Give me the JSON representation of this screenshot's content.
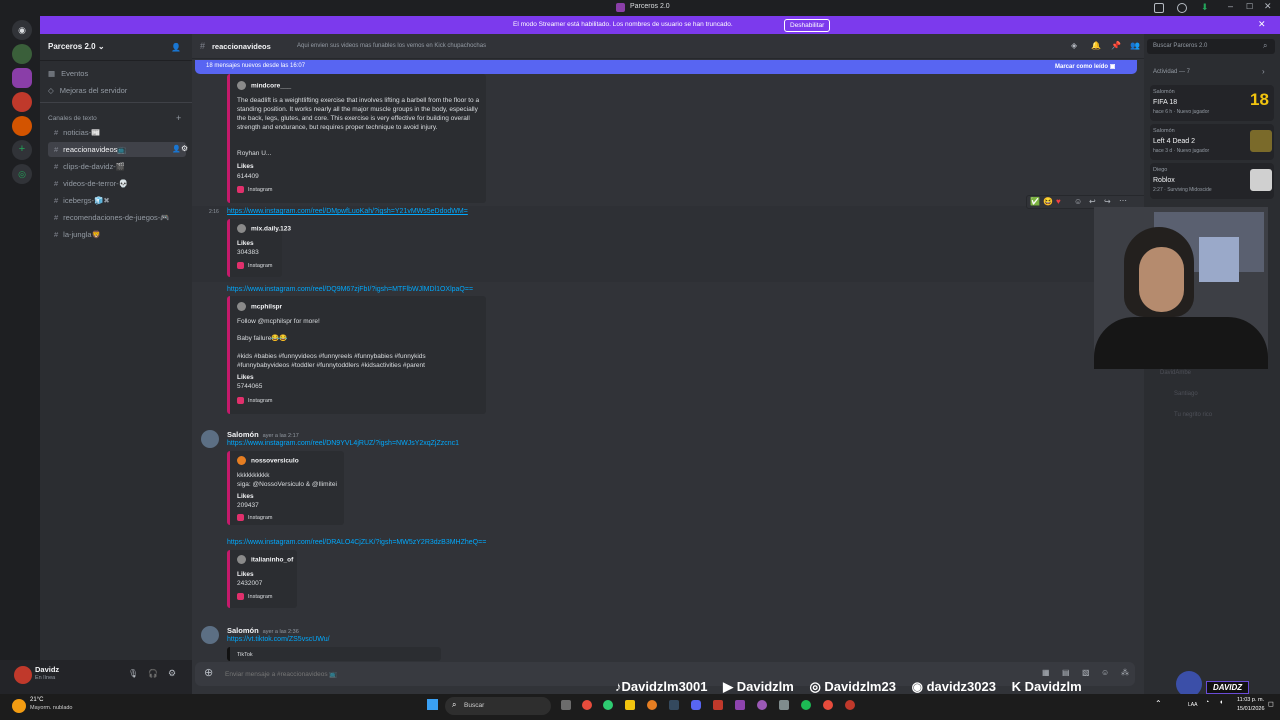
{
  "window": {
    "title": "Parceros 2.0"
  },
  "banner": {
    "text": "El modo Streamer está habilitado. Los nombres de usuario se han truncado.",
    "button": "Deshabilitar"
  },
  "server": {
    "name": "Parceros 2.0",
    "nav": [
      "Eventos",
      "Mejoras del servidor"
    ],
    "category": "Canales de texto",
    "channels": [
      {
        "name": "noticias-",
        "emoji": "📰"
      },
      {
        "name": "reaccionavideos",
        "emoji": "📺"
      },
      {
        "name": "clips-de-davidz-",
        "emoji": "🎬"
      },
      {
        "name": "videos-de-terror-",
        "emoji": "💀"
      },
      {
        "name": "icebergs-",
        "emoji": "🧊✖"
      },
      {
        "name": "recomendaciones-de-juegos-",
        "emoji": "🎮"
      },
      {
        "name": "la-jungla",
        "emoji": "🦁"
      }
    ]
  },
  "user": {
    "name": "Davidz",
    "status": "En línea"
  },
  "channel_header": {
    "name": "reaccionavideos",
    "topic": "Aqui envien sus videos mas funables los vemos en Kick chupachochas",
    "search_placeholder": "Buscar Parceros 2.0"
  },
  "new_messages": {
    "text": "18 mensajes nuevos desde las 16:07",
    "mark_read": "Marcar como leído"
  },
  "messages": {
    "embed1": {
      "author": "mindcore___",
      "body": "The deadlift is a weightlifting exercise that involves lifting a barbell from the floor to a standing position. It works nearly all the major muscle groups in the body, especially the back, legs, glutes, and core. This exercise is very effective for building overall strength and endurance, but requires proper technique to avoid injury.",
      "extra": "Royhan U...",
      "likes_label": "Likes",
      "likes": "614409",
      "source": "Instagram"
    },
    "msg2": {
      "time": "2:16",
      "link": "https://www.instagram.com/reel/DMpwfLuoKah/?igsh=Y21vMWs5eDdodWM=",
      "author": "mix.daily.123",
      "likes_label": "Likes",
      "likes": "304383",
      "source": "Instagram"
    },
    "msg3": {
      "link": "https://www.instagram.com/reel/DQ9M67zjFbI/?igsh=MTFlbWJlMDl1OXlpaQ==",
      "author": "mcphilspr",
      "line1": "Follow @mcphilspr for more!",
      "line2": "Baby failure😂😂",
      "tags": "#kids #babies #funnyvideos #funnyreels #funnybabies #funnykids #funnybabyvideos #toddler #funnytoddlers #kidsactivities #parent",
      "likes_label": "Likes",
      "likes": "5744065",
      "source": "Instagram"
    },
    "msg4": {
      "user": "Salomón",
      "time": "ayer a las 2:17",
      "link": "https://www.instagram.com/reel/DN9YVL4jRUZ/?igsh=NWJsY2xqZjZzcnc1",
      "author": "nossoversiculo",
      "line1": "kkkkkkkkkk",
      "line2": "siga: @NossoVersiculo & @Ilimitei",
      "likes_label": "Likes",
      "likes": "209437",
      "source": "Instagram"
    },
    "msg5": {
      "link": "https://www.instagram.com/reel/DRALO4CjZLK/?igsh=MW5zY2R3dzB3MHZheQ==",
      "author": "italianinho_of",
      "likes_label": "Likes",
      "likes": "2432007",
      "source": "Instagram"
    },
    "msg6": {
      "user": "Salomón",
      "time": "ayer a las 2:36",
      "link": "https://vt.tiktok.com/ZS5vscUWu/",
      "embed_title": "TikTok"
    }
  },
  "input": {
    "placeholder": "Enviar mensaje a #reaccionavideos 📺"
  },
  "activity": {
    "header": "Actividad — 7",
    "items": [
      {
        "user": "Salomón",
        "game": "FIFA 18",
        "meta": "hace 6 h",
        "tag": "Nuevo jugador",
        "badge": "18"
      },
      {
        "user": "Salomón",
        "game": "Left 4 Dead 2",
        "meta": "hace 3 d",
        "tag": "Nuevo jugador"
      },
      {
        "user": "Diego",
        "game": "Roblox",
        "meta": "2:27",
        "tag": "Surviving Midoscide"
      }
    ],
    "faded": [
      "DavidAmbe",
      "Santiago",
      "Tu negrito rico"
    ]
  },
  "social": [
    {
      "icon": "tiktok-icon",
      "handle": "Davidzlm3001"
    },
    {
      "icon": "youtube-icon",
      "handle": "Davidzlm"
    },
    {
      "icon": "instagram-icon",
      "handle": "Davidzlm23"
    },
    {
      "icon": "discord-icon",
      "handle": "davidz3023"
    },
    {
      "icon": "kick-icon",
      "handle": "Davidzlm"
    }
  ],
  "stream_logo": "DAVIDZ",
  "taskbar": {
    "weather_temp": "21°C",
    "weather_desc": "Mayorm. nublado",
    "search": "Buscar",
    "lang": "LAA",
    "time": "11:03 p. m.",
    "date": "15/01/2026"
  },
  "colors": {
    "accent": "#5865f2",
    "streamer_banner": "#7c3aed",
    "link": "#00a8fc",
    "embed_border": "#c51a6b"
  }
}
